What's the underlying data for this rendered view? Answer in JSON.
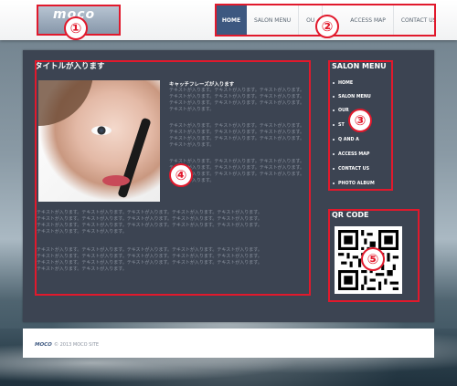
{
  "header": {
    "logo": "moco",
    "nav": [
      {
        "label": "HOME",
        "active": true
      },
      {
        "label": "SALON MENU",
        "active": false
      },
      {
        "label": "OU",
        "active": false
      },
      {
        "label": "ACCESS MAP",
        "active": false
      },
      {
        "label": "CONTACT US",
        "active": false
      }
    ]
  },
  "main": {
    "title": "タイトルが入ります",
    "catch": "キャッチフレーズが入ります",
    "right_text": [
      "テキストが入ります。テキストが入ります。テキストが入ります。",
      "テキストが入ります。テキストが入ります。テキストが入ります。",
      "テキストが入ります。テキストが入ります。テキストが入ります。",
      "テキストが入ります。",
      "テキストが入ります。テキストが入ります。テキストが入ります。",
      "テキストが入ります。テキストが入ります。テキストが入ります。",
      "テキストが入ります。テキストが入ります。テキストが入ります。",
      "テキストが入ります。",
      "テキストが入ります。テキストが入ります。テキストが入ります。",
      "テキストが入ります。テキストが入ります。テキストが入ります。",
      "テキストが入ります。テキストが入ります。テキストが入ります。",
      "テキストが入ります。"
    ],
    "full_text": [
      "テキストが入ります。テキストが入ります。テキストが入ります。テキストが入ります。テキストが入ります。",
      "テキストが入ります。テキストが入ります。テキストが入ります。テキストが入ります。テキストが入ります。",
      "テキストが入ります。テキストが入ります。テキストが入ります。テキストが入ります。テキストが入ります。",
      "テキストが入ります。テキストが入ります。",
      "テキストが入ります。テキストが入ります。テキストが入ります。テキストが入ります。テキストが入ります。",
      "テキストが入ります。テキストが入ります。テキストが入ります。テキストが入ります。テキストが入ります。",
      "テキストが入ります。テキストが入ります。テキストが入ります。テキストが入ります。テキストが入ります。",
      "テキストが入ります。テキストが入ります。"
    ]
  },
  "sidebar": {
    "menu_title": "SALON MENU",
    "menu_items": [
      "HOME",
      "SALON MENU",
      "OUR",
      "ST",
      "Q AND A",
      "ACCESS MAP",
      "CONTACT US",
      "PHOTO ALBUM"
    ],
    "qr_title": "QR CODE"
  },
  "badges": [
    "①",
    "②",
    "③",
    "④",
    "⑤"
  ],
  "footer": {
    "logo": "MOCO",
    "copyright": "© 2013 MOCO SITE"
  },
  "colors": {
    "annotation_red": "#e1192c",
    "nav_active": "#3d5880",
    "panel": "#3c4452"
  }
}
